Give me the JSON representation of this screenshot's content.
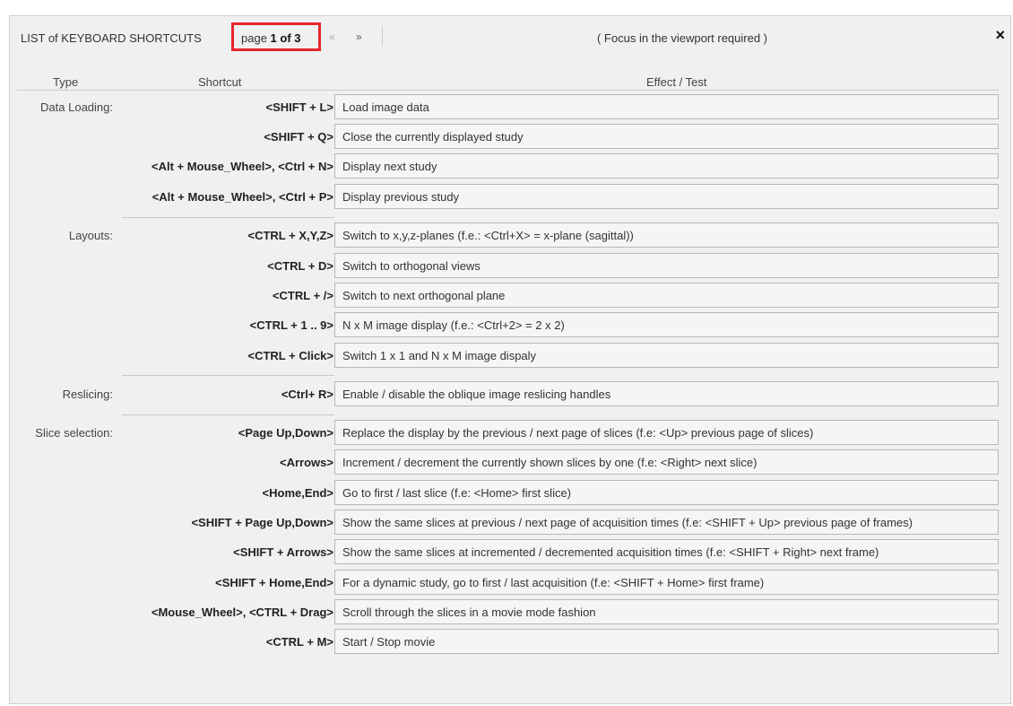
{
  "header": {
    "title": "LIST of KEYBOARD SHORTCUTS",
    "page_prefix": "page",
    "page_value": "1 of 3",
    "prev_label": "«",
    "next_label": "»",
    "focus_note": "( Focus in the viewport required )",
    "close_label": "×"
  },
  "columns": {
    "type": "Type",
    "shortcut": "Shortcut",
    "effect": "Effect / Test"
  },
  "rows": [
    {
      "type": "Data Loading:",
      "shortcut": "<SHIFT + L>",
      "effect": "Load image data"
    },
    {
      "type": "",
      "shortcut": "<SHIFT + Q>",
      "effect": "Close the currently displayed study"
    },
    {
      "type": "",
      "shortcut": "<Alt + Mouse_Wheel>, <Ctrl + N>",
      "effect": "Display next study"
    },
    {
      "type": "",
      "shortcut": "<Alt + Mouse_Wheel>, <Ctrl + P>",
      "effect": "Display previous study"
    },
    {
      "type": "Layouts:",
      "shortcut": "<CTRL + X,Y,Z>",
      "effect": "Switch to x,y,z-planes (f.e.: <Ctrl+X> = x-plane (sagittal))"
    },
    {
      "type": "",
      "shortcut": "<CTRL + D>",
      "effect": "Switch to orthogonal views"
    },
    {
      "type": "",
      "shortcut": "<CTRL + />",
      "effect": "Switch to next orthogonal plane"
    },
    {
      "type": "",
      "shortcut": "<CTRL + 1 .. 9>",
      "effect": "N x M image display (f.e.: <Ctrl+2> = 2 x 2)"
    },
    {
      "type": "",
      "shortcut": "<CTRL + Click>",
      "effect": "Switch 1 x 1 and N x M image dispaly"
    },
    {
      "type": "Reslicing:",
      "shortcut": "<Ctrl+ R>",
      "effect": "Enable / disable the oblique image reslicing handles"
    },
    {
      "type": "Slice selection:",
      "shortcut": "<Page Up,Down>",
      "effect": "Replace the display by the previous / next page of slices (f.e: <Up> previous page of slices)"
    },
    {
      "type": "",
      "shortcut": "<Arrows>",
      "effect": "Increment / decrement the currently shown slices by one (f.e: <Right> next slice)"
    },
    {
      "type": "",
      "shortcut": "<Home,End>",
      "effect": "Go to first / last slice (f.e: <Home> first slice)"
    },
    {
      "type": "",
      "shortcut": "<SHIFT + Page Up,Down>",
      "effect": "Show the same slices at previous / next page of acquisition times (f.e: <SHIFT + Up> previous page of frames)"
    },
    {
      "type": "",
      "shortcut": "<SHIFT + Arrows>",
      "effect": "Show the same slices at incremented / decremented acquisition times (f.e: <SHIFT + Right> next frame)"
    },
    {
      "type": "",
      "shortcut": "<SHIFT + Home,End>",
      "effect": "For a dynamic study, go to first / last acquisition (f.e: <SHIFT + Home> first frame)"
    },
    {
      "type": "",
      "shortcut": "<Mouse_Wheel>, <CTRL + Drag>",
      "effect": "Scroll through the slices in a movie mode fashion"
    },
    {
      "type": "",
      "shortcut": "<CTRL + M>",
      "effect": "Start / Stop movie"
    }
  ]
}
